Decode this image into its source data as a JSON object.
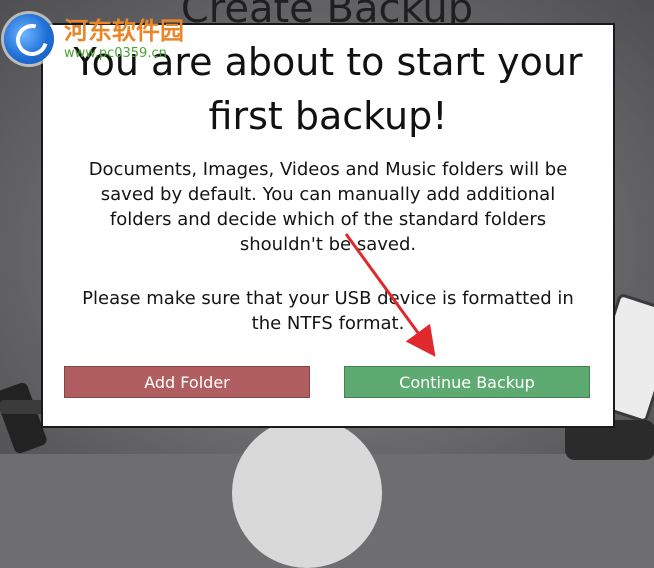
{
  "background": {
    "title": "Create Backup"
  },
  "watermark": {
    "name": "河东软件园",
    "url": "www.pc0359.cn"
  },
  "dialog": {
    "title_line1": "You are about to start your",
    "title_line2": "first backup!",
    "body": [
      "Documents, Images, Videos and Music folders will be",
      "saved by default. You can manually add additional",
      "folders and decide which of the standard folders",
      "shouldn't be saved."
    ],
    "note": [
      "Please make sure that your USB device is formatted in",
      "the NTFS format."
    ],
    "buttons": {
      "add_folder": "Add Folder",
      "continue_backup": "Continue Backup"
    }
  },
  "colors": {
    "add_folder_bg": "#b05e60",
    "continue_backup_bg": "#5eab72",
    "annotation_arrow": "#e0282d"
  },
  "icons": {
    "watermark_logo": "site-logo-icon",
    "annotation": "red-arrow-icon"
  }
}
